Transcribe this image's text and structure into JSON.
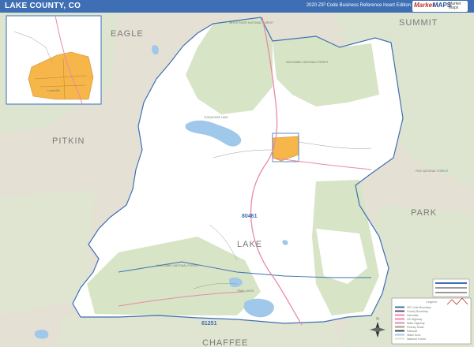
{
  "header": {
    "title": "LAKE COUNTY, CO",
    "subtitle": "2020 ZIP Code Business Reference Insert Edition",
    "logo_text_1": "Market",
    "logo_text_2": "MAPS",
    "logo_text_3": "Market Maps"
  },
  "map": {
    "neighbors": {
      "eagle": "EAGLE",
      "summit": "SUMMIT",
      "pitkin": "PITKIN",
      "park": "PARK",
      "chaffee": "CHAFFEE"
    },
    "county_label": "LAKE",
    "zip_labels": {
      "north": "80461",
      "south": "81251"
    },
    "feature_labels": {
      "white_river_nf": "WHITE RIVER NATIONAL FOREST",
      "san_isabel_nf_north": "SAN ISABEL NATIONAL FOREST",
      "san_isabel_nf_south": "SAN ISABEL NATIONAL FOREST",
      "pike_nf": "PIKE NATIONAL FOREST",
      "turquoise_lake": "TURQUOISE LAKE",
      "twin_lakes": "TWIN LAKES"
    },
    "colors": {
      "forest": "#d7e4c6",
      "background": "#e5e0d4",
      "water": "#9fc8ea",
      "boundary": "#3e6fb4",
      "highway": "#e88aa8",
      "city": "#f6b64a"
    }
  },
  "inset": {
    "label": "Leadville"
  },
  "legend": {
    "title": "Legend",
    "rows": [
      "ZIP Code Boundary",
      "County Boundary",
      "Interstate",
      "US Highway",
      "State Highway",
      "Primary Road",
      "Railroad",
      "Water Area",
      "National Forest"
    ]
  },
  "compass": {
    "label": "N"
  }
}
